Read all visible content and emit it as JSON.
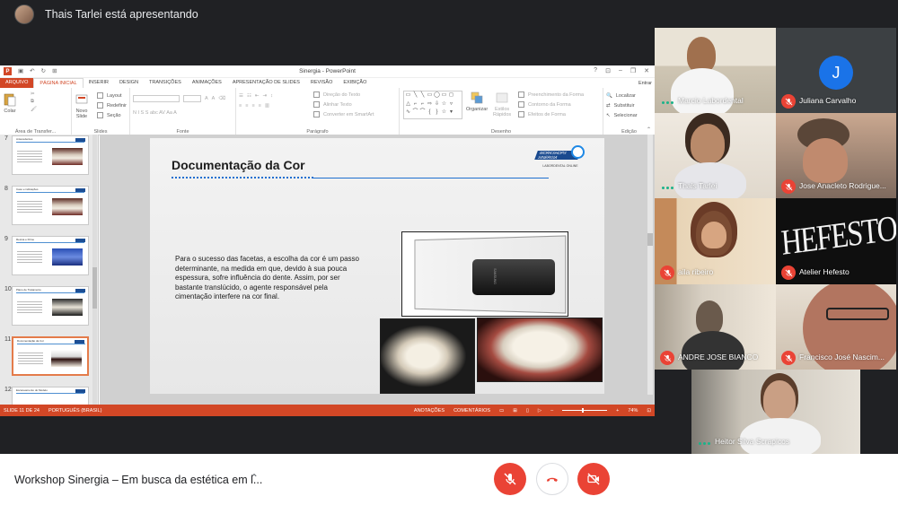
{
  "header": {
    "presenter_text": "Thais Tarlei está apresentando"
  },
  "ppt": {
    "window_title": "Sinergia - PowerPoint",
    "signin": "Entrar",
    "tabs": [
      "ARQUIVO",
      "PÁGINA INICIAL",
      "INSERIR",
      "DESIGN",
      "TRANSIÇÕES",
      "ANIMAÇÕES",
      "APRESENTAÇÃO DE SLIDES",
      "REVISÃO",
      "EXIBIÇÃO"
    ],
    "ribbon": {
      "paste": "Colar",
      "clipboard_group": "Área de Transfer...",
      "new_slide_1": "Novo",
      "new_slide_2": "Slide",
      "layout": "Layout",
      "reset": "Redefinir",
      "section": "Seção",
      "slides_group": "Slides",
      "font_group": "Fonte",
      "font_letters": "N I S S abc AV Aa A",
      "text_direction": "Direção do Texto",
      "align_text": "Alinhar Texto",
      "smartart": "Converter em SmartArt",
      "paragraph_group": "Parágrafo",
      "arrange": "Organizar",
      "quick_styles_1": "Estilos",
      "quick_styles_2": "Rápidos",
      "shape_fill": "Preenchimento da Forma",
      "shape_outline": "Contorno da Forma",
      "shape_effects": "Efeitos de Forma",
      "drawing_group": "Desenho",
      "find": "Localizar",
      "replace": "Substituir",
      "select": "Selecionar",
      "editing_group": "Edição"
    },
    "thumbnails": [
      {
        "num": "7",
        "title": "Antecedentes"
      },
      {
        "num": "8",
        "title": "Caso e indicações"
      },
      {
        "num": "9",
        "title": "Resina e Filme"
      },
      {
        "num": "10",
        "title": "Plano de Tratamento"
      },
      {
        "num": "11",
        "title": "Documentação da Cor"
      },
      {
        "num": "12",
        "title": "Escaneamento do Modelo"
      }
    ],
    "slide": {
      "title": "Documentação da Cor",
      "logo_line1": "WORKSHOPS",
      "logo_line2": "SINERGIA",
      "logo_sub": "LABORDENTAL ONLINE",
      "body": "Para o sucesso das facetas, a escolha da cor é um passo determinante, na medida em que, devido à sua pouca espessura, sofre influência do dente. Assim, por ser bastante translúcido, o agente responsável pela cimentação interfere na cor final."
    },
    "status": {
      "slide_count": "SLIDE 11 DE 24",
      "language": "PORTUGUÊS (BRASIL)",
      "notes": "ANOTAÇÕES",
      "comments": "COMENTÁRIOS",
      "zoom": "74%"
    }
  },
  "participants": [
    {
      "name": "Marcio Labordental",
      "muted": false
    },
    {
      "name": "Juliana Carvalho",
      "muted": true,
      "initial": "J"
    },
    {
      "name": "Thais Tarlei",
      "muted": false
    },
    {
      "name": "Jose Anacleto Rodrigue...",
      "muted": true
    },
    {
      "name": "aila ribeiro",
      "muted": true
    },
    {
      "name": "Atelier Hefesto",
      "muted": true
    },
    {
      "name": "ANDRE JOSE BIANCO",
      "muted": true
    },
    {
      "name": "Francisco José Nascim...",
      "muted": true
    },
    {
      "name": "Heitor Silva Scrapicos",
      "muted": false
    }
  ],
  "bottom": {
    "meeting_name": "Workshop Sinergia – Em busca da estética em l..."
  },
  "colors": {
    "mute_red": "#ea4335",
    "ppt_orange": "#d24726",
    "active_speaker": "#1ab38a",
    "avatar_blue": "#1a73e8"
  }
}
